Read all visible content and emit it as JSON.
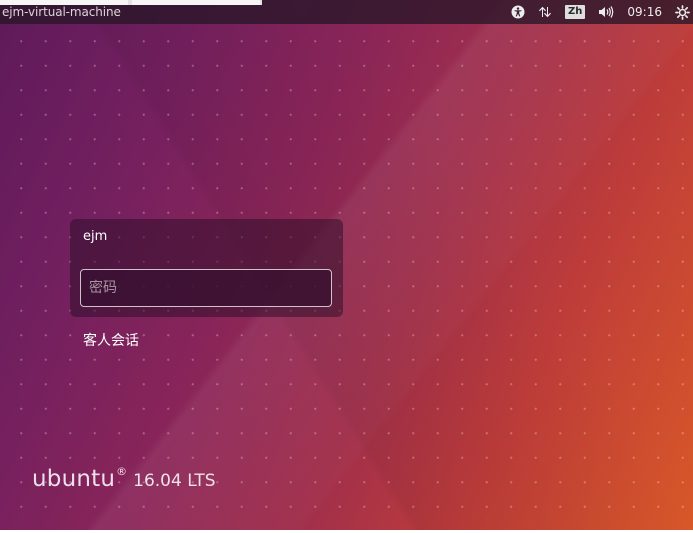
{
  "top_panel": {
    "hostname": "ejm-virtual-machine",
    "language": "Zh",
    "clock": "09:16",
    "indicators": [
      "accessibility-icon",
      "network-icon",
      "language-indicator",
      "volume-icon",
      "clock",
      "power-icon"
    ]
  },
  "login": {
    "user": "ejm",
    "password_placeholder": "密码",
    "guest_session": "客人会话"
  },
  "branding": {
    "word": "ubuntu",
    "mark": "®",
    "version": "16.04 LTS"
  },
  "colors": {
    "wallpaper_start": "#5e1a5a",
    "wallpaper_end": "#d85828",
    "panel": "#2b1629",
    "login_box": "#2d0e28"
  }
}
